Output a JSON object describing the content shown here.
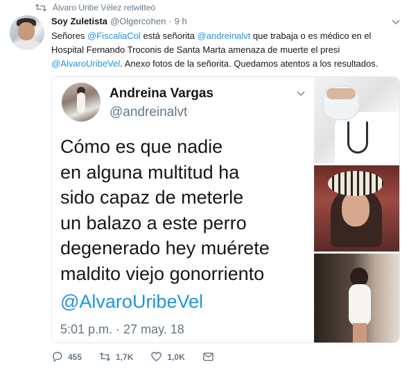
{
  "retweet": {
    "label": "Álvaro Uribe Vélez retwitteó",
    "icon": "retweet-icon"
  },
  "tweet": {
    "author_name": "Soy Zuletista",
    "author_handle": "@Olgercohen",
    "separator": "·",
    "time": "9 h",
    "text_parts": {
      "p1": "Señores ",
      "m1": "@FiscaliaCol",
      "p2": " está señorita ",
      "m2": "@andreinalvt",
      "p3": " que trabaja o es médico en el Hospital Fernando Troconis de Santa Marta amenaza de muerte el presi ",
      "m3": "@AlvaroUribeVel",
      "p4": ". Anexo fotos de la señorita. Quedamos atentos a los resultados."
    }
  },
  "embedded_tweet": {
    "name": "Andreina Vargas",
    "handle": "@andreinalvt",
    "lines": [
      "Cómo es que nadie",
      "en alguna multitud ha",
      "sido capaz de meterle",
      "un balazo a este perro",
      "degenerado hey muérete",
      "maldito viejo gonorriento"
    ],
    "mention": "@AlvaroUribeVel",
    "timestamp": "5:01 p.m. · 27 may. 18"
  },
  "actions": {
    "replies": "455",
    "retweets": "1,7K",
    "likes": "1,0K"
  },
  "colors": {
    "link": "#1b95e0",
    "secondary_text": "#657786",
    "border": "#e1e8ed"
  }
}
